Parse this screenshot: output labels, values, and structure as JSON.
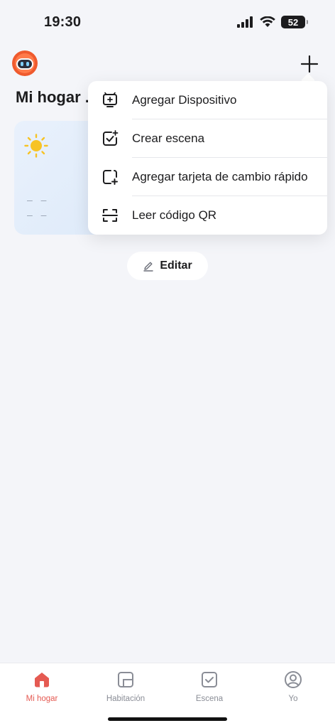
{
  "status_bar": {
    "time": "19:30",
    "battery": "52",
    "icons": [
      "signal-icon",
      "wifi-icon",
      "battery-icon"
    ]
  },
  "header": {
    "title": "Mi hogar .",
    "avatar_icon": "robot-avatar-icon",
    "add_icon": "plus-icon"
  },
  "weather_card": {
    "icon": "sun-icon",
    "line1": "– –",
    "line2": "– –"
  },
  "edit_button": {
    "label": "Editar",
    "icon": "pencil-icon"
  },
  "dropdown": {
    "items": [
      {
        "label": "Agregar Dispositivo",
        "icon": "add-device-icon"
      },
      {
        "label": "Crear escena",
        "icon": "create-scene-icon"
      },
      {
        "label": "Agregar tarjeta de cambio rápido",
        "icon": "add-card-icon"
      },
      {
        "label": "Leer código QR",
        "icon": "qr-scan-icon"
      }
    ]
  },
  "tab_bar": {
    "tabs": [
      {
        "label": "Mi hogar",
        "icon": "home-icon",
        "active": true
      },
      {
        "label": "Habitación",
        "icon": "room-icon",
        "active": false
      },
      {
        "label": "Escena",
        "icon": "scene-icon",
        "active": false
      },
      {
        "label": "Yo",
        "icon": "profile-icon",
        "active": false
      }
    ]
  },
  "colors": {
    "accent": "#e55a52",
    "background": "#f4f5f9",
    "sun": "#f7c325"
  }
}
